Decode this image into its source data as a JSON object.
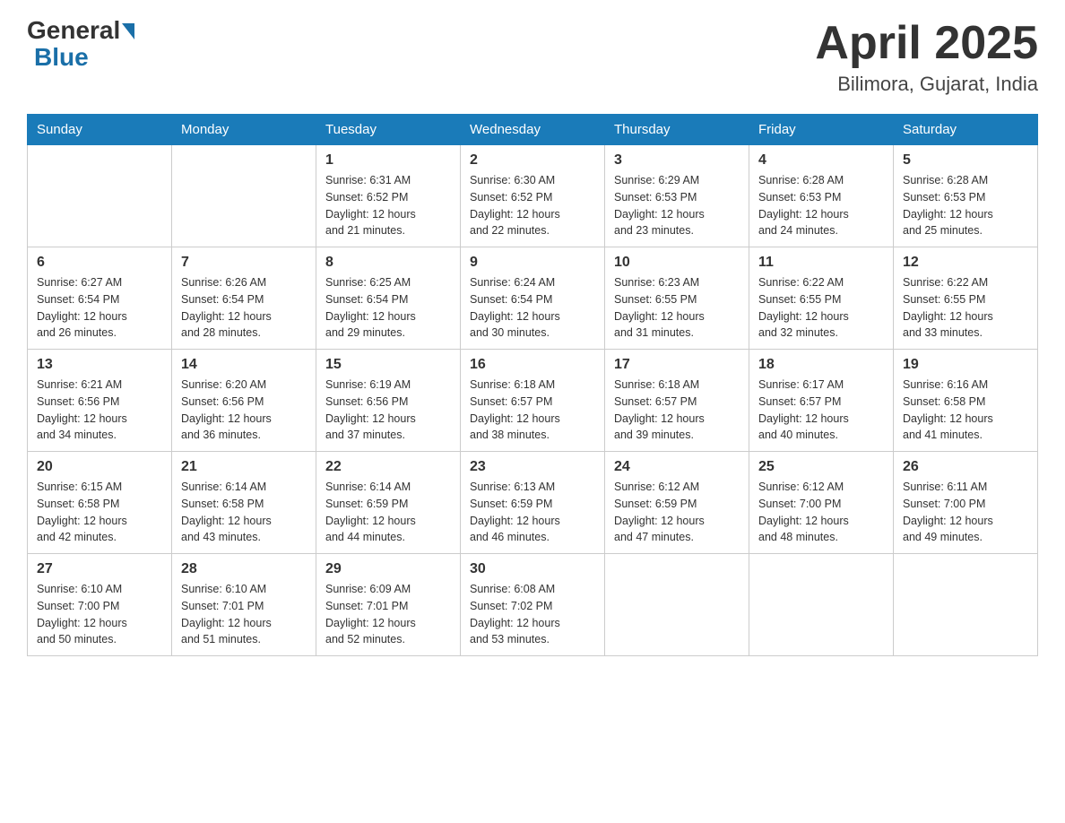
{
  "header": {
    "logo": {
      "general": "General",
      "blue": "Blue"
    },
    "title": "April 2025",
    "subtitle": "Bilimora, Gujarat, India"
  },
  "weekdays": [
    "Sunday",
    "Monday",
    "Tuesday",
    "Wednesday",
    "Thursday",
    "Friday",
    "Saturday"
  ],
  "weeks": [
    [
      {
        "day": "",
        "info": ""
      },
      {
        "day": "",
        "info": ""
      },
      {
        "day": "1",
        "info": "Sunrise: 6:31 AM\nSunset: 6:52 PM\nDaylight: 12 hours\nand 21 minutes."
      },
      {
        "day": "2",
        "info": "Sunrise: 6:30 AM\nSunset: 6:52 PM\nDaylight: 12 hours\nand 22 minutes."
      },
      {
        "day": "3",
        "info": "Sunrise: 6:29 AM\nSunset: 6:53 PM\nDaylight: 12 hours\nand 23 minutes."
      },
      {
        "day": "4",
        "info": "Sunrise: 6:28 AM\nSunset: 6:53 PM\nDaylight: 12 hours\nand 24 minutes."
      },
      {
        "day": "5",
        "info": "Sunrise: 6:28 AM\nSunset: 6:53 PM\nDaylight: 12 hours\nand 25 minutes."
      }
    ],
    [
      {
        "day": "6",
        "info": "Sunrise: 6:27 AM\nSunset: 6:54 PM\nDaylight: 12 hours\nand 26 minutes."
      },
      {
        "day": "7",
        "info": "Sunrise: 6:26 AM\nSunset: 6:54 PM\nDaylight: 12 hours\nand 28 minutes."
      },
      {
        "day": "8",
        "info": "Sunrise: 6:25 AM\nSunset: 6:54 PM\nDaylight: 12 hours\nand 29 minutes."
      },
      {
        "day": "9",
        "info": "Sunrise: 6:24 AM\nSunset: 6:54 PM\nDaylight: 12 hours\nand 30 minutes."
      },
      {
        "day": "10",
        "info": "Sunrise: 6:23 AM\nSunset: 6:55 PM\nDaylight: 12 hours\nand 31 minutes."
      },
      {
        "day": "11",
        "info": "Sunrise: 6:22 AM\nSunset: 6:55 PM\nDaylight: 12 hours\nand 32 minutes."
      },
      {
        "day": "12",
        "info": "Sunrise: 6:22 AM\nSunset: 6:55 PM\nDaylight: 12 hours\nand 33 minutes."
      }
    ],
    [
      {
        "day": "13",
        "info": "Sunrise: 6:21 AM\nSunset: 6:56 PM\nDaylight: 12 hours\nand 34 minutes."
      },
      {
        "day": "14",
        "info": "Sunrise: 6:20 AM\nSunset: 6:56 PM\nDaylight: 12 hours\nand 36 minutes."
      },
      {
        "day": "15",
        "info": "Sunrise: 6:19 AM\nSunset: 6:56 PM\nDaylight: 12 hours\nand 37 minutes."
      },
      {
        "day": "16",
        "info": "Sunrise: 6:18 AM\nSunset: 6:57 PM\nDaylight: 12 hours\nand 38 minutes."
      },
      {
        "day": "17",
        "info": "Sunrise: 6:18 AM\nSunset: 6:57 PM\nDaylight: 12 hours\nand 39 minutes."
      },
      {
        "day": "18",
        "info": "Sunrise: 6:17 AM\nSunset: 6:57 PM\nDaylight: 12 hours\nand 40 minutes."
      },
      {
        "day": "19",
        "info": "Sunrise: 6:16 AM\nSunset: 6:58 PM\nDaylight: 12 hours\nand 41 minutes."
      }
    ],
    [
      {
        "day": "20",
        "info": "Sunrise: 6:15 AM\nSunset: 6:58 PM\nDaylight: 12 hours\nand 42 minutes."
      },
      {
        "day": "21",
        "info": "Sunrise: 6:14 AM\nSunset: 6:58 PM\nDaylight: 12 hours\nand 43 minutes."
      },
      {
        "day": "22",
        "info": "Sunrise: 6:14 AM\nSunset: 6:59 PM\nDaylight: 12 hours\nand 44 minutes."
      },
      {
        "day": "23",
        "info": "Sunrise: 6:13 AM\nSunset: 6:59 PM\nDaylight: 12 hours\nand 46 minutes."
      },
      {
        "day": "24",
        "info": "Sunrise: 6:12 AM\nSunset: 6:59 PM\nDaylight: 12 hours\nand 47 minutes."
      },
      {
        "day": "25",
        "info": "Sunrise: 6:12 AM\nSunset: 7:00 PM\nDaylight: 12 hours\nand 48 minutes."
      },
      {
        "day": "26",
        "info": "Sunrise: 6:11 AM\nSunset: 7:00 PM\nDaylight: 12 hours\nand 49 minutes."
      }
    ],
    [
      {
        "day": "27",
        "info": "Sunrise: 6:10 AM\nSunset: 7:00 PM\nDaylight: 12 hours\nand 50 minutes."
      },
      {
        "day": "28",
        "info": "Sunrise: 6:10 AM\nSunset: 7:01 PM\nDaylight: 12 hours\nand 51 minutes."
      },
      {
        "day": "29",
        "info": "Sunrise: 6:09 AM\nSunset: 7:01 PM\nDaylight: 12 hours\nand 52 minutes."
      },
      {
        "day": "30",
        "info": "Sunrise: 6:08 AM\nSunset: 7:02 PM\nDaylight: 12 hours\nand 53 minutes."
      },
      {
        "day": "",
        "info": ""
      },
      {
        "day": "",
        "info": ""
      },
      {
        "day": "",
        "info": ""
      }
    ]
  ]
}
